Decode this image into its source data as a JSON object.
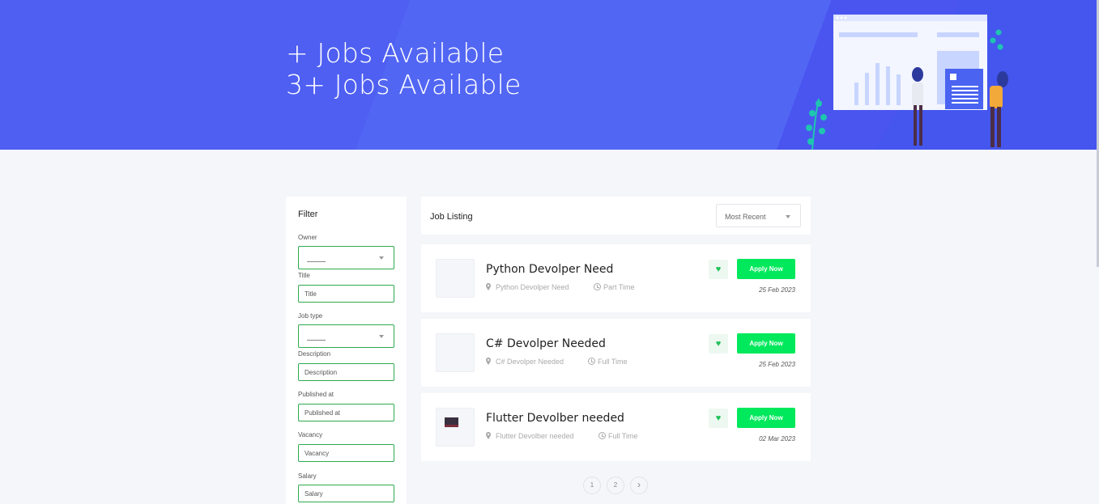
{
  "hero": {
    "line1": "+ Jobs Available",
    "line2": "3+ Jobs Available"
  },
  "filter": {
    "title": "Filter",
    "owner_label": "Owner",
    "title_label": "Title",
    "title_placeholder": "Title",
    "job_type_label": "Job type",
    "description_label": "Description",
    "description_placeholder": "Description",
    "published_label": "Published at",
    "published_placeholder": "Published at",
    "vacancy_label": "Vacancy",
    "vacancy_placeholder": "Vacancy",
    "salary_label": "Salary",
    "salary_placeholder": "Salary"
  },
  "listing": {
    "title": "Job Listing",
    "sort_value": "Most Recent"
  },
  "jobs": [
    {
      "title": "Python Devolper Need",
      "location": "Python Devolper Need",
      "type": "Part Time",
      "date": "25 Feb 2023",
      "apply": "Apply Now"
    },
    {
      "title": "C# Devolper Needed",
      "location": "C# Devolper Needed",
      "type": "Full Time",
      "date": "25 Feb 2023",
      "apply": "Apply Now"
    },
    {
      "title": "Flutter Devolber needed",
      "location": "Flutter Devolber needed",
      "type": "Full Time",
      "date": "02 Mar 2023",
      "apply": "Apply Now"
    }
  ],
  "pagination": {
    "page1": "1",
    "page2": "2",
    "next": "›"
  },
  "colors": {
    "hero": "#4a55ef",
    "accent": "#00e85c",
    "field_border": "#2eaa4f"
  }
}
